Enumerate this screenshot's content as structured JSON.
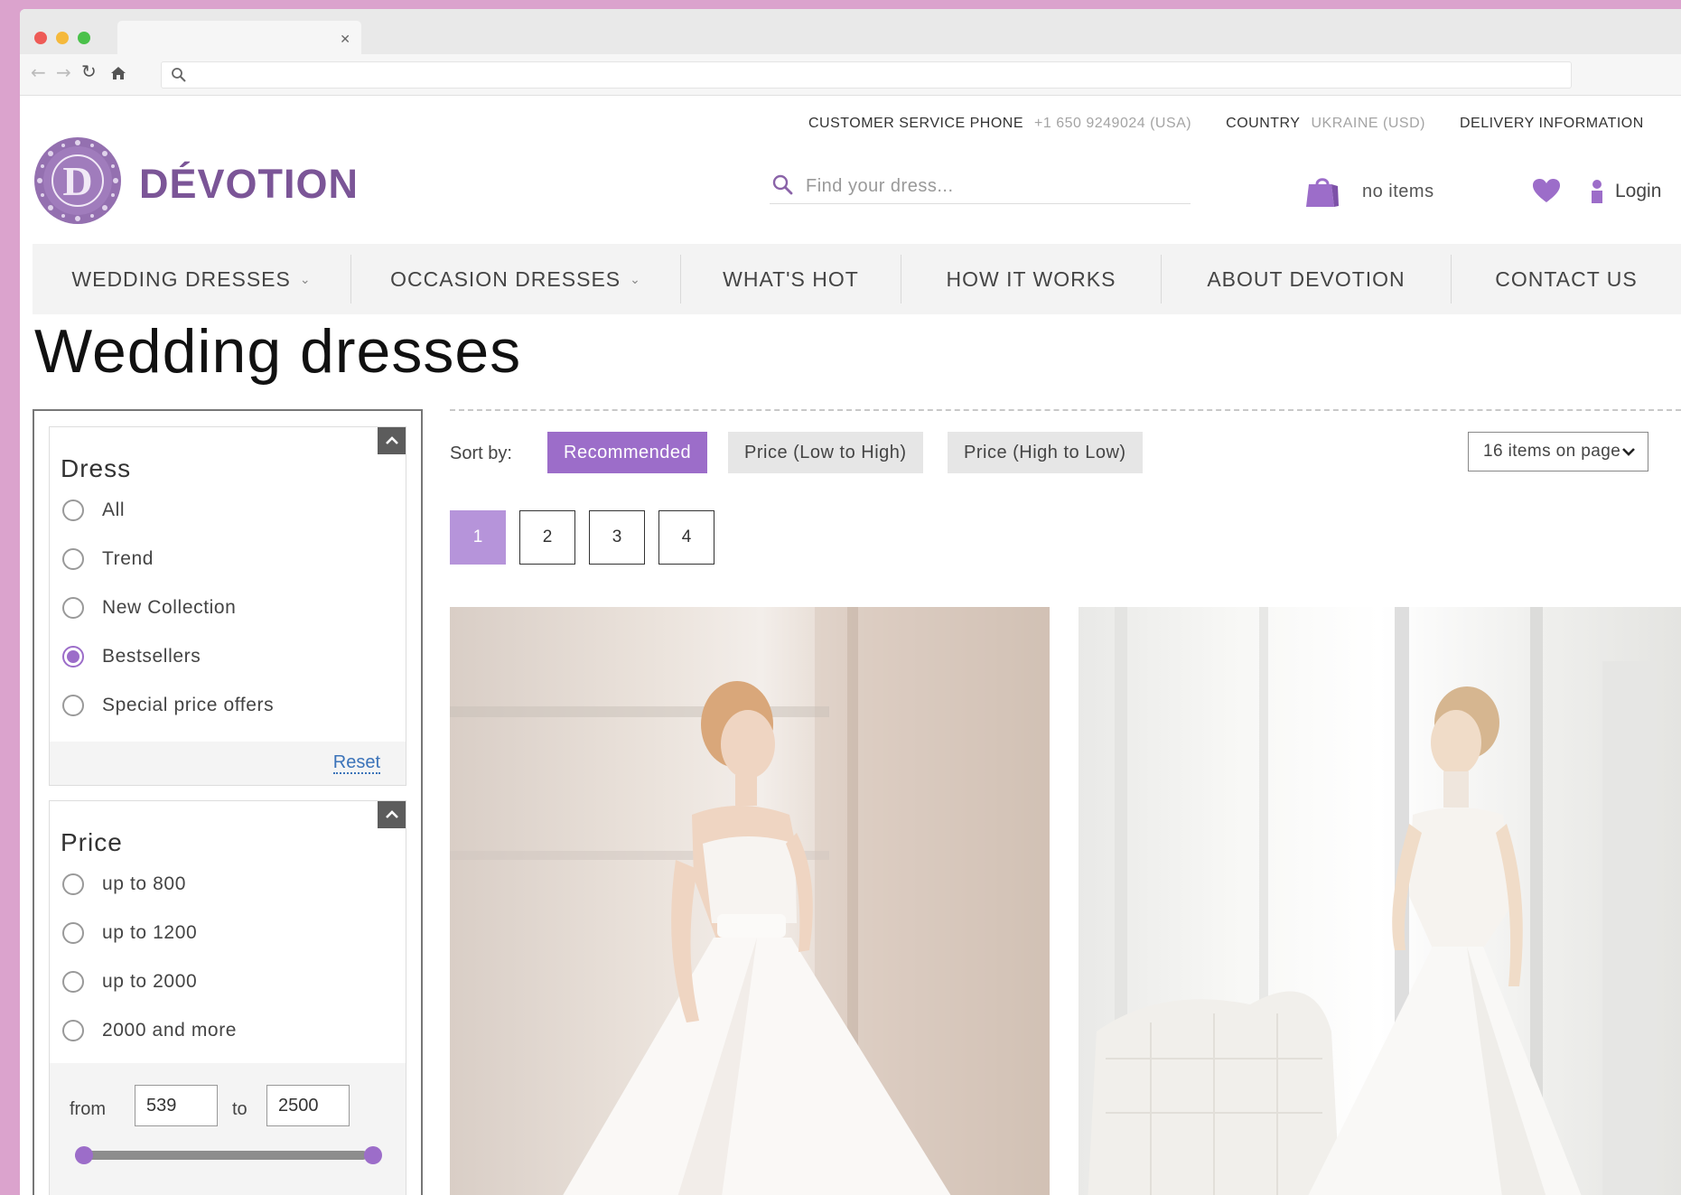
{
  "topbar": {
    "phone_label": "CUSTOMER SERVICE PHONE",
    "phone_value": "+1 650 9249024 (USA)",
    "country_label": "COUNTRY",
    "country_value": "UKRAINE (USD)",
    "delivery_label": "DELIVERY INFORMATION"
  },
  "header": {
    "brand": "DÉVOTION",
    "search_placeholder": "Find your dress...",
    "cart_label": "no items",
    "login_label": "Login"
  },
  "nav": {
    "items": [
      {
        "label": "WEDDING DRESSES",
        "has_dropdown": true
      },
      {
        "label": "OCCASION DRESSES",
        "has_dropdown": true
      },
      {
        "label": "WHAT'S HOT"
      },
      {
        "label": "HOW IT WORKS"
      },
      {
        "label": "ABOUT DEVOTION"
      },
      {
        "label": "CONTACT US"
      }
    ]
  },
  "page": {
    "title": "Wedding dresses"
  },
  "filters": {
    "dress": {
      "title": "Dress",
      "options": [
        "All",
        "Trend",
        "New Collection",
        "Bestsellers",
        "Special price offers"
      ],
      "selected": "Bestsellers",
      "reset_label": "Reset"
    },
    "price": {
      "title": "Price",
      "options": [
        "up to 800",
        "up to 1200",
        "up to 2000",
        "2000 and more"
      ],
      "from_label": "from",
      "from_value": "539",
      "to_label": "to",
      "to_value": "2500"
    }
  },
  "sort": {
    "label": "Sort by:",
    "options": [
      "Recommended",
      "Price (Low to High)",
      "Price (High to Low)"
    ],
    "active": "Recommended",
    "per_page": "16 items on page"
  },
  "pagination": {
    "pages": [
      "1",
      "2",
      "3",
      "4"
    ],
    "current": "1"
  },
  "colors": {
    "accent": "#9c6dc9",
    "brand": "#7b5597",
    "page_bg": "#dba3cd"
  },
  "icons": [
    "search-icon",
    "shopping-bag-icon",
    "heart-icon",
    "user-icon",
    "chevron-up-icon",
    "chevron-down-icon",
    "back-arrow-icon",
    "forward-arrow-icon",
    "reload-icon",
    "home-icon",
    "close-icon"
  ]
}
